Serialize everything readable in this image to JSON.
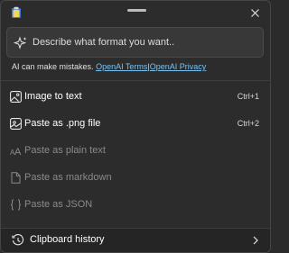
{
  "titlebar": {
    "app_icon": "clipboard-app-icon",
    "drag_handle": "drag-handle",
    "close_icon": "close-icon"
  },
  "prompt": {
    "placeholder": "Describe what format you want..",
    "icon": "sparkle-icon"
  },
  "disclaimer": {
    "text": "AI can make mistakes.",
    "terms_link": "OpenAI Terms",
    "separator": "|",
    "privacy_link": "OpenAI Privacy"
  },
  "menu": [
    {
      "label": "Image to text",
      "shortcut": "Ctrl+1",
      "icon": "image-icon",
      "enabled": true
    },
    {
      "label": "Paste as .png file",
      "shortcut": "Ctrl+2",
      "icon": "png-file-icon",
      "enabled": true
    },
    {
      "label": "Paste as plain text",
      "shortcut": "",
      "icon": "text-aa-icon",
      "enabled": false
    },
    {
      "label": "Paste as markdown",
      "shortcut": "",
      "icon": "document-icon",
      "enabled": false
    },
    {
      "label": "Paste as JSON",
      "shortcut": "",
      "icon": "braces-icon",
      "enabled": false
    }
  ],
  "history": {
    "label": "Clipboard history",
    "icon": "clipboard-history-icon",
    "chevron": "chevron-right-icon"
  },
  "colors": {
    "background": "#2c2c2c",
    "link": "#79c1f0",
    "disabled_text": "#8a8a8a",
    "footer": "#252525"
  }
}
